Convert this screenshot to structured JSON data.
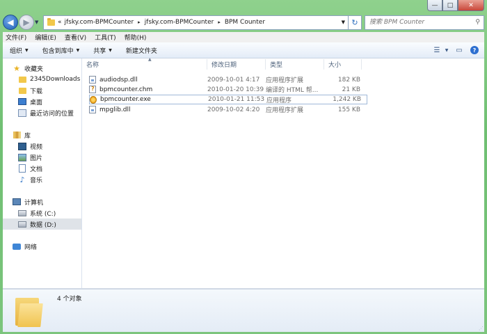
{
  "window": {
    "caption_min": "—",
    "caption_max": "□",
    "caption_close": "✕"
  },
  "address": {
    "overflow": "«",
    "crumbs": [
      "jfsky.com-BPMCounter",
      "jfsky.com-BPMCounter",
      "BPM Counter"
    ],
    "separator": "▸",
    "search_placeholder": "搜索 BPM Counter"
  },
  "menu": [
    "文件(F)",
    "编辑(E)",
    "查看(V)",
    "工具(T)",
    "帮助(H)"
  ],
  "toolbar": {
    "organize": "组织",
    "include_in_library": "包含到库中",
    "share": "共享",
    "new_folder": "新建文件夹"
  },
  "nav": {
    "favorites": {
      "label": "收藏夹",
      "items": [
        "2345Downloads",
        "下载",
        "桌面",
        "最近访问的位置"
      ]
    },
    "libraries": {
      "label": "库",
      "items": [
        "视频",
        "图片",
        "文档",
        "音乐"
      ]
    },
    "computer": {
      "label": "计算机",
      "items": [
        "系统 (C:)",
        "数据 (D:)"
      ]
    },
    "network": {
      "label": "网络"
    }
  },
  "columns": {
    "name": "名称",
    "date": "修改日期",
    "type": "类型",
    "size": "大小"
  },
  "files": [
    {
      "name": "audiodsp.dll",
      "date": "2009-10-01 4:17",
      "type": "应用程序扩展",
      "size": "182 KB"
    },
    {
      "name": "bpmcounter.chm",
      "date": "2010-01-20 10:39",
      "type": "编译的 HTML 帮...",
      "size": "21 KB"
    },
    {
      "name": "bpmcounter.exe",
      "date": "2010-01-21 11:53",
      "type": "应用程序",
      "size": "1,242 KB"
    },
    {
      "name": "mpglib.dll",
      "date": "2009-10-02 4:20",
      "type": "应用程序扩展",
      "size": "155 KB"
    }
  ],
  "details": {
    "count": "4 个对象"
  }
}
